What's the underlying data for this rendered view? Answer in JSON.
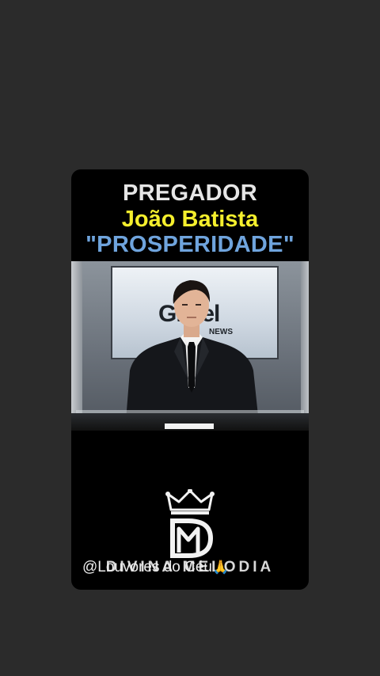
{
  "titles": {
    "line1": "PREGADOR",
    "line2": "João Batista",
    "line3": "\"PROSPERIDADE\""
  },
  "video": {
    "screen_logo": "Gl bel",
    "screen_logo_sub": "NEWS"
  },
  "watermark": {
    "brand_name": "DIVINA MELODIA",
    "handle": "@Louvores do Céu",
    "emoji": "🙏"
  },
  "colors": {
    "background": "#2b2b2b",
    "title_white": "#e6e6e6",
    "title_yellow": "#f5ef2d",
    "title_blue": "#6fa4dd"
  }
}
